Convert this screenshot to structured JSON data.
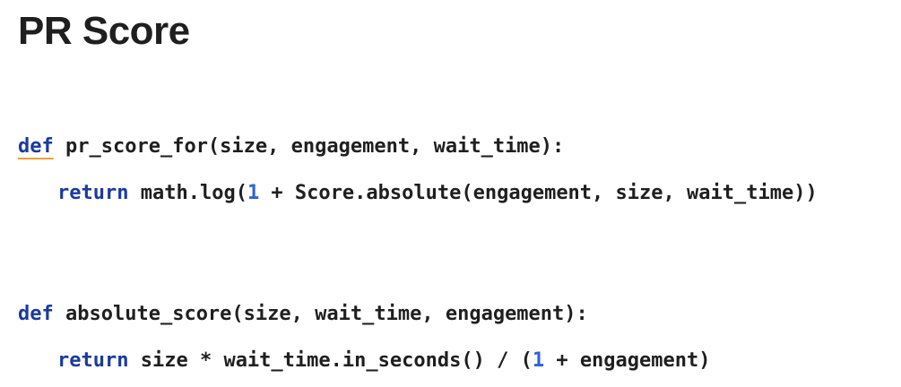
{
  "page": {
    "title": "PR Score"
  },
  "code": {
    "fn1": {
      "def_kw": "def",
      "signature": " pr_score_for(size, engagement, wait_time):",
      "return_kw": "return",
      "body_pre": " math.log(",
      "body_num": "1",
      "body_post": " + Score.absolute(engagement, size, wait_time))"
    },
    "fn2": {
      "def_kw": "def",
      "signature": " absolute_score(size, wait_time, engagement):",
      "return_kw": "return",
      "body_pre": " size * wait_time.in_seconds() / (",
      "body_num": "1",
      "body_post": " + engagement)"
    }
  },
  "colors": {
    "keyword": "#1a3a9e",
    "number": "#2f62d8",
    "text": "#1f1f1f",
    "spellcheck_underline": "#f0a030"
  }
}
